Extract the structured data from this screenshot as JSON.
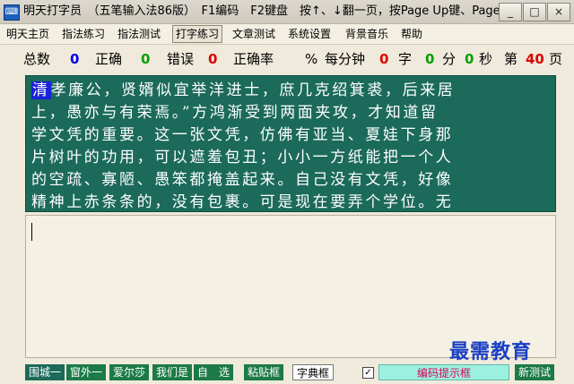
{
  "window": {
    "title": "明天打字员　（五笔输入法86版）　F1编码　F2键盘　按↑、↓翻一页，按Page Up键、Page...",
    "controls": {
      "minimize": "_",
      "maximize": "□",
      "close": "×"
    }
  },
  "menu": [
    "明天主页",
    "指法练习",
    "指法测试",
    "打字练习",
    "文章测试",
    "系统设置",
    "背景音乐",
    "帮助"
  ],
  "stats": {
    "total_label": "总数",
    "total_value": "0",
    "correct_label": "正确",
    "correct_value": "0",
    "error_label": "错误",
    "error_value": "0",
    "rate_label": "正确率",
    "rate_unit": "%",
    "per_minute_label": "每分钟",
    "per_minute_value": "0",
    "char_unit": "字",
    "minutes_value": "0",
    "minutes_unit": "分",
    "seconds_value": "0",
    "seconds_unit": "秒",
    "page_prefix": "第",
    "page_value": "40",
    "page_suffix": "页"
  },
  "practice_text": {
    "current_char": "清",
    "lines": [
      "孝廉公，贤婿似宜举洋进士，庶几克绍箕裘，后来居",
      "上，愚亦与有荣焉。”方鸿渐受到两面夹攻，才知道留",
      "学文凭的重要。这一张文凭，仿佛有亚当、夏娃下身那",
      "片树叶的功用，可以遮羞包丑；小小一方纸能把一个人",
      "的空疏、寡陋、愚笨都掩盖起来。自己没有文凭，好像",
      "精神上赤条条的，没有包裹。可是现在要弄个学位。无"
    ]
  },
  "footer": {
    "tabs": [
      "围城一",
      "窗外一",
      "爱尔莎",
      "我们是",
      "自　选"
    ],
    "paste_button": "粘贴框",
    "dict_button": "字典框",
    "checkbox_mark": "✓",
    "hint_box": "编码提示框",
    "new_test_button": "新测试"
  },
  "watermark": "最需教育"
}
